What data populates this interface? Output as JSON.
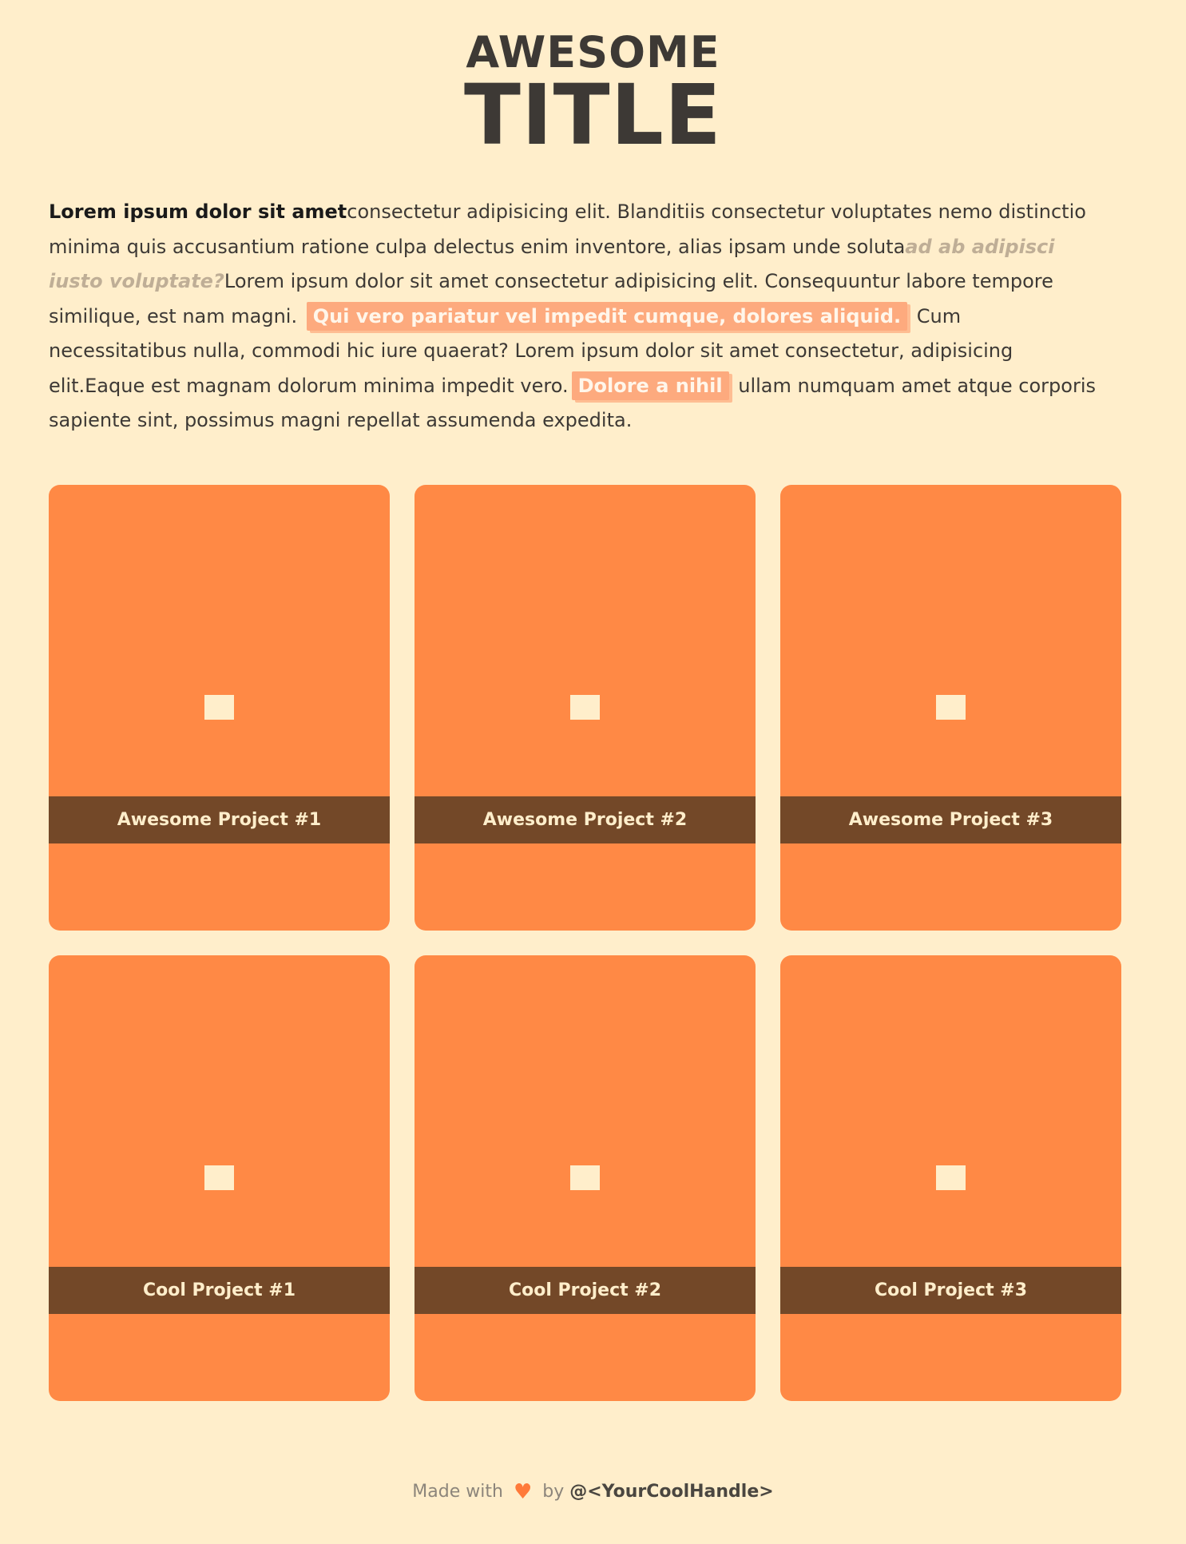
{
  "header": {
    "title_top": "AWESOME",
    "title_bottom": "TITLE"
  },
  "intro": {
    "lead": "Lorem ipsum dolor sit amet",
    "text1": "consectetur adipisicing elit. Blanditiis consectetur voluptates nemo distinctio minima quis accusantium ratione culpa delectus enim inventore, alias ipsam unde soluta",
    "muted": "ad ab adipisci iusto voluptate?",
    "text2": "Lorem ipsum dolor sit amet consectetur adipisicing elit. Consequuntur labore tempore similique, est nam magni.",
    "highlight1": "Qui vero pariatur vel impedit cumque, dolores aliquid.",
    "text3": "Cum necessitatibus nulla, commodi hic iure quaerat? Lorem ipsum dolor sit amet consectetur, adipisicing elit.Eaque est magnam dolorum minima impedit vero.",
    "highlight2": "Dolore a nihil",
    "text4": "ullam numquam amet atque corporis sapiente sint, possimus magni repellat assumenda expedita."
  },
  "projects": [
    {
      "title": "Awesome Project #1"
    },
    {
      "title": "Awesome Project #2"
    },
    {
      "title": "Awesome Project #3"
    },
    {
      "title": "Cool Project #1"
    },
    {
      "title": "Cool Project #2"
    },
    {
      "title": "Cool Project #3"
    }
  ],
  "footer": {
    "made_with": "Made with",
    "heart_icon": "heart-icon",
    "by": "by",
    "handle": "@<YourCoolHandle>"
  },
  "colors": {
    "background": "#ffeecb",
    "card": "#ff8945",
    "caption_band": "#734828",
    "highlight": "#fdaa7e",
    "title": "#3d3935"
  }
}
